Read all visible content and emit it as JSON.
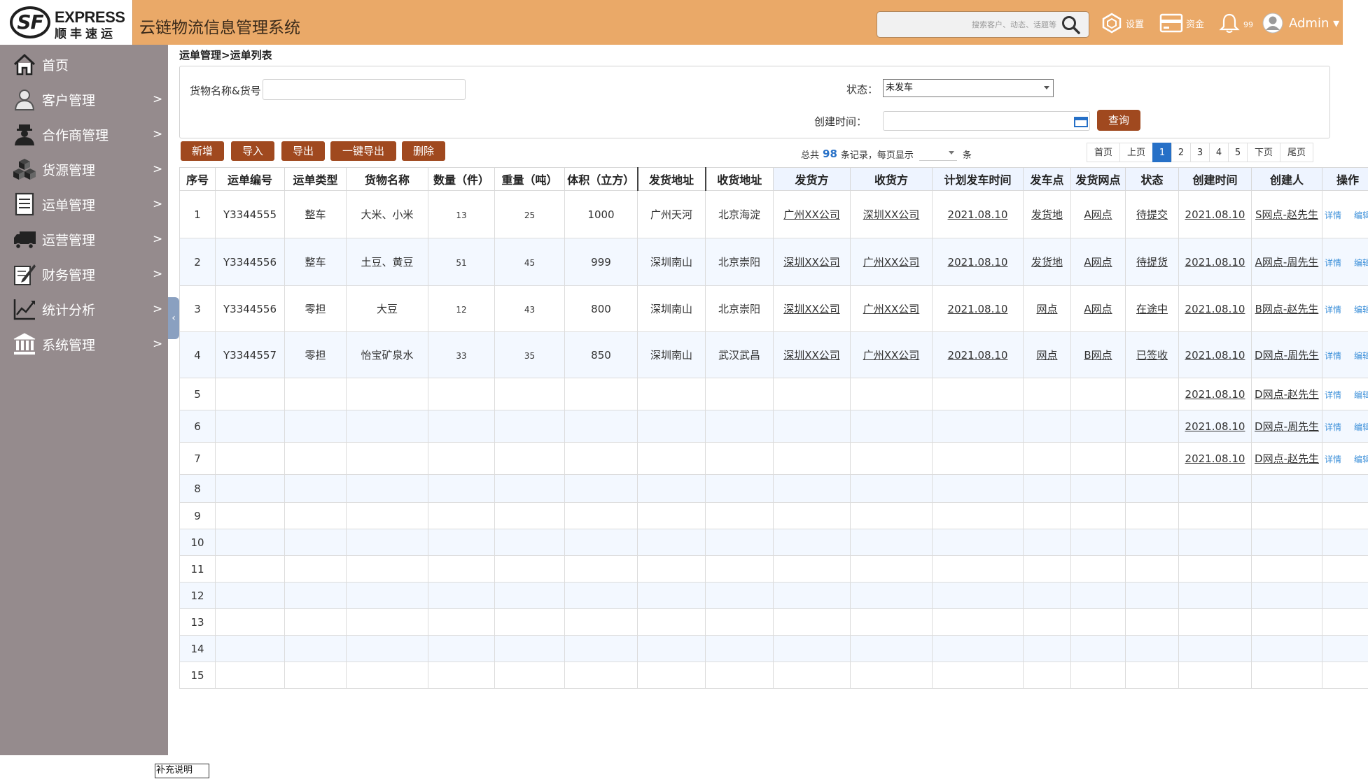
{
  "header": {
    "logo_text": "SF",
    "logo_en": "EXPRESS",
    "logo_cn": "顺丰速运",
    "app_title": "云链物流信息管理系统",
    "search_placeholder": "搜索客户、动态、话题等",
    "settings_label": "设置",
    "funds_label": "资金",
    "notify_count": "99",
    "user_label": "Admin ▾"
  },
  "sidebar": {
    "items": [
      {
        "label": "首页",
        "arrow": "",
        "icon": "home-icon"
      },
      {
        "label": "客户管理",
        "arrow": ">",
        "icon": "user-icon"
      },
      {
        "label": "合作商管理",
        "arrow": ">",
        "icon": "partner-icon"
      },
      {
        "label": "货源管理",
        "arrow": ">",
        "icon": "boxes-icon"
      },
      {
        "label": "运单管理",
        "arrow": ">",
        "icon": "document-icon"
      },
      {
        "label": "运营管理",
        "arrow": ">",
        "icon": "truck-icon"
      },
      {
        "label": "财务管理",
        "arrow": ">",
        "icon": "finance-icon"
      },
      {
        "label": "统计分析",
        "arrow": ">",
        "icon": "chart-icon"
      },
      {
        "label": "系统管理",
        "arrow": ">",
        "icon": "bank-icon"
      }
    ],
    "collapse_glyph": "‹"
  },
  "breadcrumb": "运单管理>运单列表",
  "filters": {
    "goods_label": "货物名称&货号：",
    "status_label": "状态：",
    "status_value": "未发车",
    "time_label": "创建时间：",
    "query_label": "查询"
  },
  "toolbar": {
    "add": "新增",
    "import": "导入",
    "export": "导出",
    "export_all": "一键导出",
    "delete": "删除"
  },
  "records": {
    "prefix": "总共",
    "count": "98",
    "middle": "条记录，每页显示",
    "suffix": "条"
  },
  "pager": {
    "first": "首页",
    "prev": "上页",
    "pages": [
      "1",
      "2",
      "3",
      "4",
      "5"
    ],
    "current": "1",
    "next": "下页",
    "last": "尾页"
  },
  "table": {
    "columns": [
      "序号",
      "运单编号",
      "运单类型",
      "货物名称",
      "数量（件）",
      "重量（吨）",
      "体积（立方）",
      "发货地址",
      "收货地址",
      "发货方",
      "收货方",
      "计划发车时间",
      "发车点",
      "发货网点",
      "状态",
      "创建时间",
      "创建人",
      "操作"
    ],
    "detail_label": "详情",
    "edit_label": "编辑",
    "rows": [
      {
        "no": "1",
        "id": "Y3344555",
        "type": "整车",
        "goods": "大米、小米",
        "qty": "13",
        "weight": "25",
        "volume": "1000",
        "from": "广州天河",
        "to": "北京海淀",
        "shipper": "广州XX公司",
        "receiver": "深圳XX公司",
        "plan": "2021.08.10",
        "depart": "发货地",
        "branch": "A网点",
        "status": "待提交",
        "created": "2021.08.10",
        "creator": "S网点-赵先生"
      },
      {
        "no": "2",
        "id": "Y3344556",
        "type": "整车",
        "goods": "土豆、黄豆",
        "qty": "51",
        "weight": "45",
        "volume": "999",
        "from": "深圳南山",
        "to": "北京崇阳",
        "shipper": "深圳XX公司",
        "receiver": "广州XX公司",
        "plan": "2021.08.10",
        "depart": "发货地",
        "branch": "A网点",
        "status": "待提货",
        "created": "2021.08.10",
        "creator": "A网点-周先生"
      },
      {
        "no": "3",
        "id": "Y3344556",
        "type": "零担",
        "goods": "大豆",
        "qty": "12",
        "weight": "43",
        "volume": "800",
        "from": "深圳南山",
        "to": "北京崇阳",
        "shipper": "深圳XX公司",
        "receiver": "广州XX公司",
        "plan": "2021.08.10",
        "depart": "网点",
        "branch": "A网点",
        "status": "在途中",
        "created": "2021.08.10",
        "creator": "B网点-赵先生"
      },
      {
        "no": "4",
        "id": "Y3344557",
        "type": "零担",
        "goods": "怡宝矿泉水",
        "qty": "33",
        "weight": "35",
        "volume": "850",
        "from": "深圳南山",
        "to": "武汉武昌",
        "shipper": "深圳XX公司",
        "receiver": "广州XX公司",
        "plan": "2021.08.10",
        "depart": "网点",
        "branch": "B网点",
        "status": "已签收",
        "created": "2021.08.10",
        "creator": "D网点-周先生"
      },
      {
        "no": "5",
        "created": "2021.08.10",
        "creator": "D网点-赵先生"
      },
      {
        "no": "6",
        "created": "2021.08.10",
        "creator": "D网点-周先生"
      },
      {
        "no": "7",
        "created": "2021.08.10",
        "creator": "D网点-赵先生"
      },
      {
        "no": "8"
      },
      {
        "no": "9"
      },
      {
        "no": "10"
      },
      {
        "no": "11"
      },
      {
        "no": "12"
      },
      {
        "no": "13"
      },
      {
        "no": "14"
      },
      {
        "no": "15"
      }
    ]
  },
  "footer_note": "补充说明",
  "colors": {
    "header_bg": "#eaa968",
    "sidebar_bg": "#958b8d",
    "button_bg": "#a0491f",
    "accent_blue": "#2670c7",
    "row_alt": "#f3f8ff"
  }
}
